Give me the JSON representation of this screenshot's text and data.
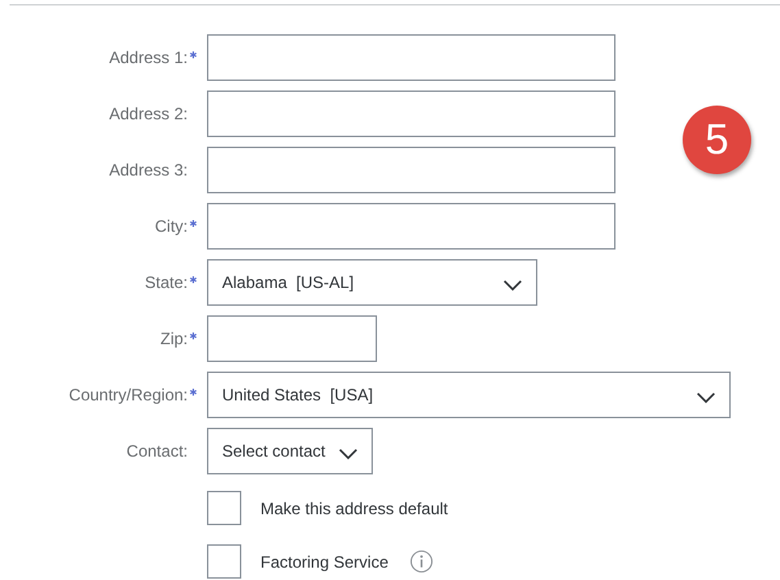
{
  "badge": "5",
  "fields": [
    {
      "label": "Address 1:",
      "required": true,
      "kind": "text"
    },
    {
      "label": "Address 2:",
      "required": false,
      "kind": "text"
    },
    {
      "label": "Address 3:",
      "required": false,
      "kind": "text"
    },
    {
      "label": "City:",
      "required": true,
      "kind": "text"
    },
    {
      "label": "State:",
      "required": true,
      "kind": "select",
      "value": "Alabama  [US-AL]"
    },
    {
      "label": "Zip:",
      "required": true,
      "kind": "text"
    },
    {
      "label": "Country/Region:",
      "required": true,
      "kind": "select",
      "value": "United States  [USA]"
    },
    {
      "label": "Contact:",
      "required": false,
      "kind": "select",
      "value": "Select contact"
    }
  ],
  "checkboxes": [
    {
      "label": "Make this address default",
      "checked": false,
      "info": false
    },
    {
      "label": "Factoring Service",
      "checked": false,
      "info": true
    }
  ]
}
